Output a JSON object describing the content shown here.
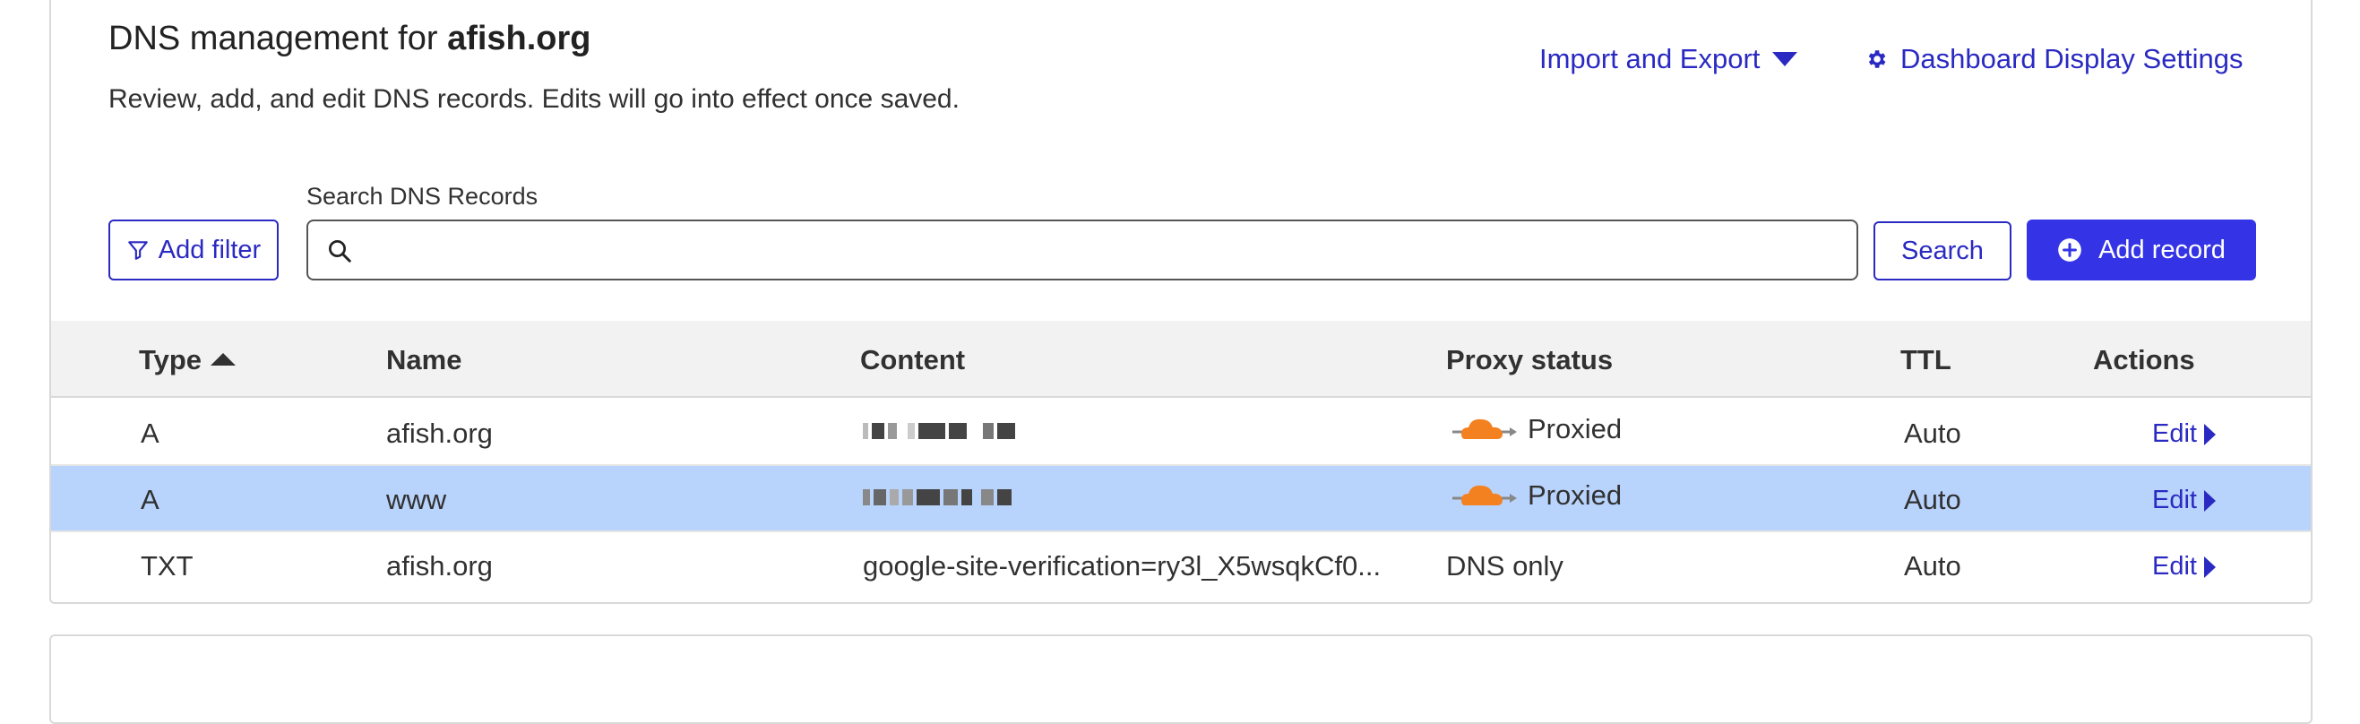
{
  "header": {
    "title_prefix": "DNS management for ",
    "domain": "afish.org",
    "subtitle": "Review, add, and edit DNS records. Edits will go into effect once saved.",
    "import_export_label": "Import and Export",
    "dashboard_settings_label": "Dashboard Display Settings"
  },
  "toolbar": {
    "add_filter_label": "Add filter",
    "search_label": "Search DNS Records",
    "search_value": "",
    "search_placeholder": "",
    "search_button_label": "Search",
    "add_record_label": "Add record"
  },
  "table": {
    "columns": [
      "Type",
      "Name",
      "Content",
      "Proxy status",
      "TTL",
      "Actions"
    ],
    "sort_column": "Type",
    "sort_direction": "ascending",
    "rows": [
      {
        "type": "A",
        "name": "afish.org",
        "content": "",
        "content_redacted": true,
        "proxy_status": "Proxied",
        "ttl": "Auto",
        "action": "Edit",
        "selected": false
      },
      {
        "type": "A",
        "name": "www",
        "content": "",
        "content_redacted": true,
        "proxy_status": "Proxied",
        "ttl": "Auto",
        "action": "Edit",
        "selected": true
      },
      {
        "type": "TXT",
        "name": "afish.org",
        "content": "google-site-verification=ry3l_X5wsqkCf0...",
        "content_redacted": false,
        "proxy_status": "DNS only",
        "ttl": "Auto",
        "action": "Edit",
        "selected": false
      }
    ]
  },
  "colors": {
    "link": "#2a2ac2",
    "primary_button": "#3434e6",
    "selected_row": "#b8d3fc",
    "header_bg": "#f2f2f2",
    "proxy_cloud": "#f48120"
  },
  "icons": {
    "filter": "filter-icon",
    "search": "search-icon",
    "settings": "gear-icon",
    "add": "plus-circle-icon",
    "proxy": "cloud-icon",
    "dropdown": "caret-down-icon",
    "edit": "caret-right-icon"
  }
}
